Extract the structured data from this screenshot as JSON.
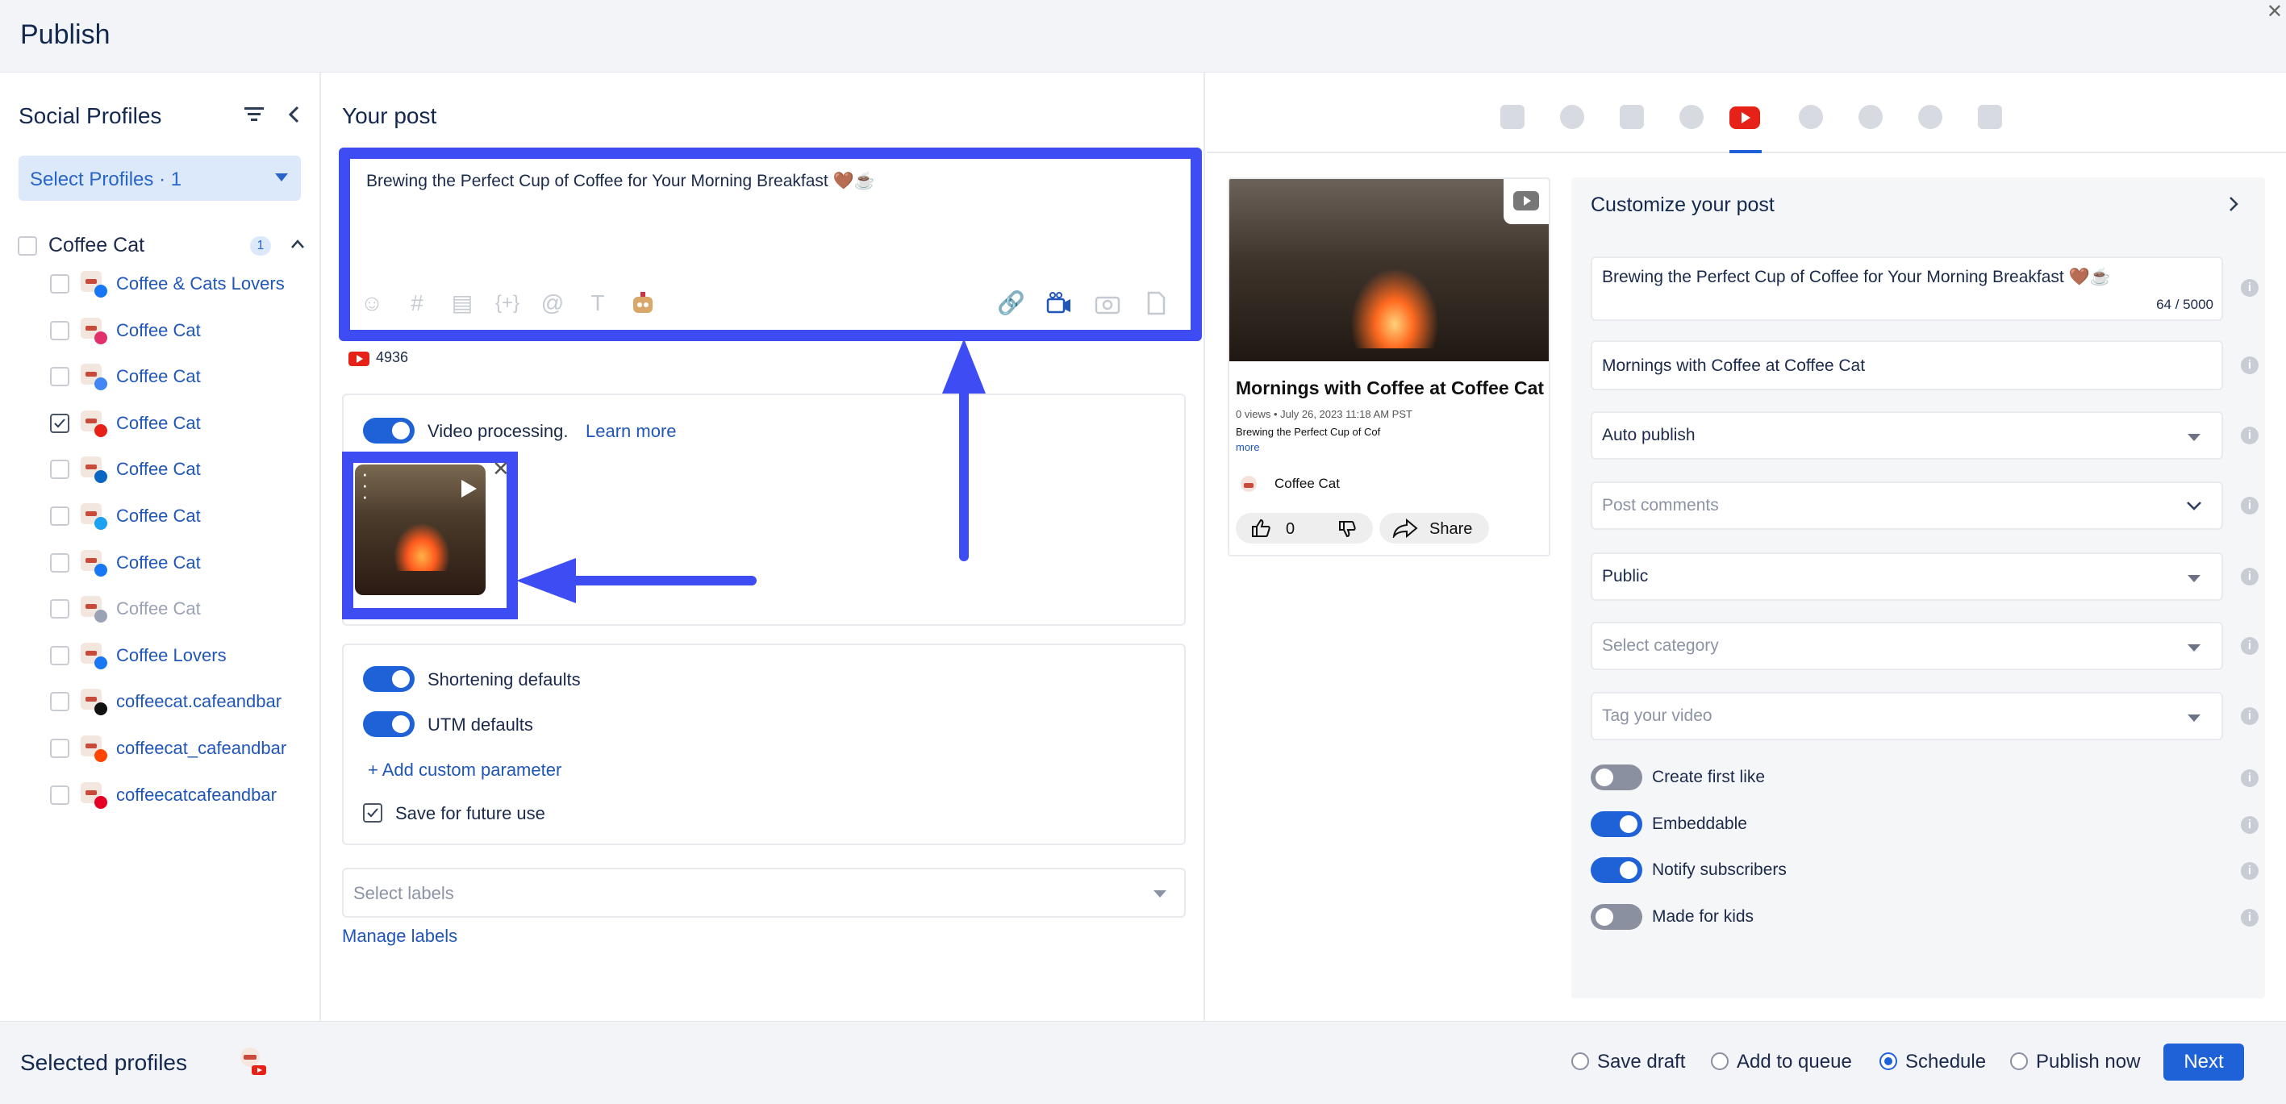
{
  "header": {
    "title": "Publish"
  },
  "profiles_panel": {
    "title": "Social Profiles",
    "select_label": "Select Profiles · 1",
    "group": {
      "name": "Coffee Cat",
      "count": "1"
    },
    "items": [
      {
        "name": "Coffee & Cats Lovers",
        "network": "facebook",
        "checked": false,
        "disabled": false
      },
      {
        "name": "Coffee Cat",
        "network": "instagram",
        "checked": false,
        "disabled": false
      },
      {
        "name": "Coffee Cat",
        "network": "google",
        "checked": false,
        "disabled": false
      },
      {
        "name": "Coffee Cat",
        "network": "youtube",
        "checked": true,
        "disabled": false
      },
      {
        "name": "Coffee Cat",
        "network": "linkedin",
        "checked": false,
        "disabled": false
      },
      {
        "name": "Coffee Cat",
        "network": "twitter",
        "checked": false,
        "disabled": false
      },
      {
        "name": "Coffee Cat",
        "network": "facebook",
        "checked": false,
        "disabled": false
      },
      {
        "name": "Coffee Cat",
        "network": "other",
        "checked": false,
        "disabled": true
      },
      {
        "name": "Coffee Lovers",
        "network": "facebook",
        "checked": false,
        "disabled": false
      },
      {
        "name": "coffeecat.cafeandbar",
        "network": "tiktok",
        "checked": false,
        "disabled": false
      },
      {
        "name": "coffeecat_cafeandbar",
        "network": "reddit",
        "checked": false,
        "disabled": false
      },
      {
        "name": "coffeecatcafeandbar",
        "network": "pinterest",
        "checked": false,
        "disabled": false
      }
    ]
  },
  "post": {
    "title": "Your post",
    "text": "Brewing the Perfect Cup of Coffee for Your Morning Breakfast 🤎☕",
    "char_count": "4936",
    "video_processing_label": "Video processing.",
    "learn_more": "Learn more",
    "shortening_label": "Shortening defaults",
    "utm_label": "UTM defaults",
    "add_param": "Add custom parameter",
    "save_future": "Save for future use",
    "labels_placeholder": "Select labels",
    "manage_labels": "Manage labels"
  },
  "preview": {
    "title": "Mornings with Coffee at Coffee Cat",
    "meta": "0 views • July 26, 2023 11:18 AM PST",
    "description": "Brewing the Perfect Cup of Cof",
    "more": "more",
    "channel": "Coffee Cat",
    "likes": "0",
    "share": "Share"
  },
  "customize": {
    "title": "Customize your post",
    "video_title": "Brewing the Perfect Cup of Coffee for Your Morning Breakfast 🤎☕",
    "title_count": "64 / 5000",
    "description": "Mornings with Coffee at Coffee Cat",
    "publish_mode": "Auto publish",
    "comments_placeholder": "Post comments",
    "privacy": "Public",
    "category_placeholder": "Select category",
    "tags_placeholder": "Tag your video",
    "options": [
      {
        "label": "Create first like",
        "on": false
      },
      {
        "label": "Embeddable",
        "on": true
      },
      {
        "label": "Notify subscribers",
        "on": true
      },
      {
        "label": "Made for kids",
        "on": false
      }
    ]
  },
  "footer": {
    "selected_label": "Selected profiles",
    "save_draft": "Save draft",
    "add_queue": "Add to queue",
    "schedule": "Schedule",
    "publish_now": "Publish now",
    "selected_option": "schedule",
    "next": "Next"
  },
  "colors": {
    "accent": "#1f62d8",
    "annotation": "#3e4cf3",
    "youtube": "#e62117"
  }
}
